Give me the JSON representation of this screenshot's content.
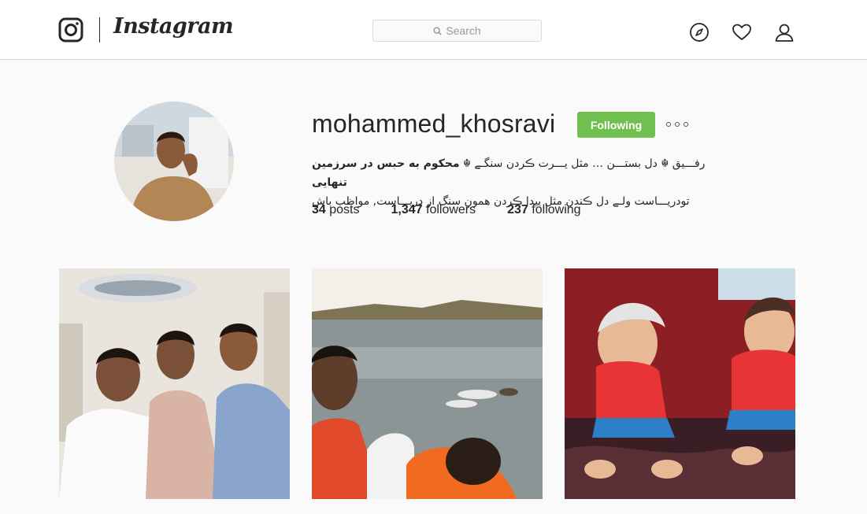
{
  "app": {
    "wordmark": "Instagram",
    "search_placeholder": "Search"
  },
  "nav": {
    "icons": [
      "explore-icon",
      "activity-heart-icon",
      "profile-icon"
    ]
  },
  "profile": {
    "username": "mohammed_khosravi",
    "follow_status": "Following",
    "bio_line1_part1": "رفـــیق ☬ دل بستـــن … مثل یـــرت ڪردن سنگـے ☬ ",
    "bio_line1_bold": "محکوم به حبس در سرزمین تنهایی",
    "bio_line2": "تودریـــاست ولـے دل ڪندن مثل پیدا ڪردن همون سنگ از دریـــاست, مواظب باش",
    "posts_count": "34",
    "posts_label": "posts",
    "followers_count": "1,347",
    "followers_label": "followers",
    "following_count": "237",
    "following_label": "following"
  },
  "colors": {
    "following_button": "#70c050",
    "border": "#dbdbdb",
    "background": "#fafafa"
  },
  "photos": [
    "group-selfie",
    "lake-selfie",
    "baby-photo"
  ]
}
